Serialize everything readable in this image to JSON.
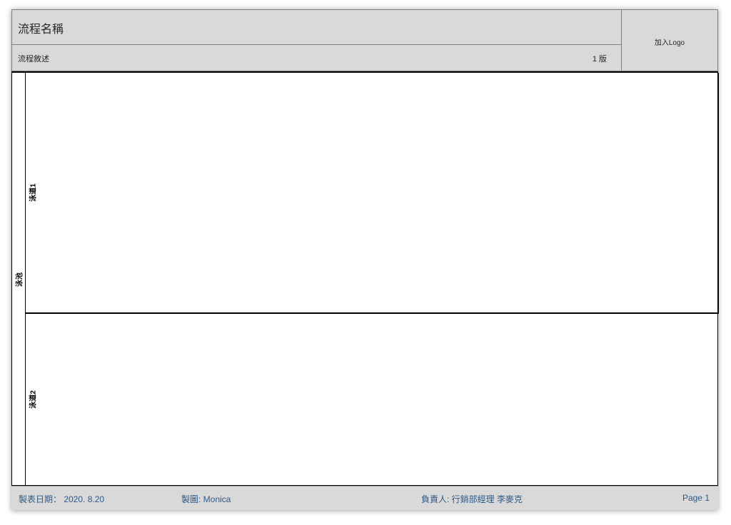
{
  "header": {
    "title": "流程名稱",
    "description": "流程敘述",
    "version": "1 版",
    "logo_placeholder": "加入Logo"
  },
  "pool": {
    "label": "泳池",
    "lanes": [
      {
        "label": "泳道1"
      },
      {
        "label": "泳道2"
      }
    ]
  },
  "footer": {
    "date": "製表日期： 2020. 8.20",
    "author": "製圖: Monica",
    "owner": "負責人: 行銷部經理 李麥克",
    "page": "Page 1"
  },
  "colors": {
    "header_fill": "#d9d9d9",
    "footer_text": "#2e5a87",
    "border": "#000000"
  }
}
